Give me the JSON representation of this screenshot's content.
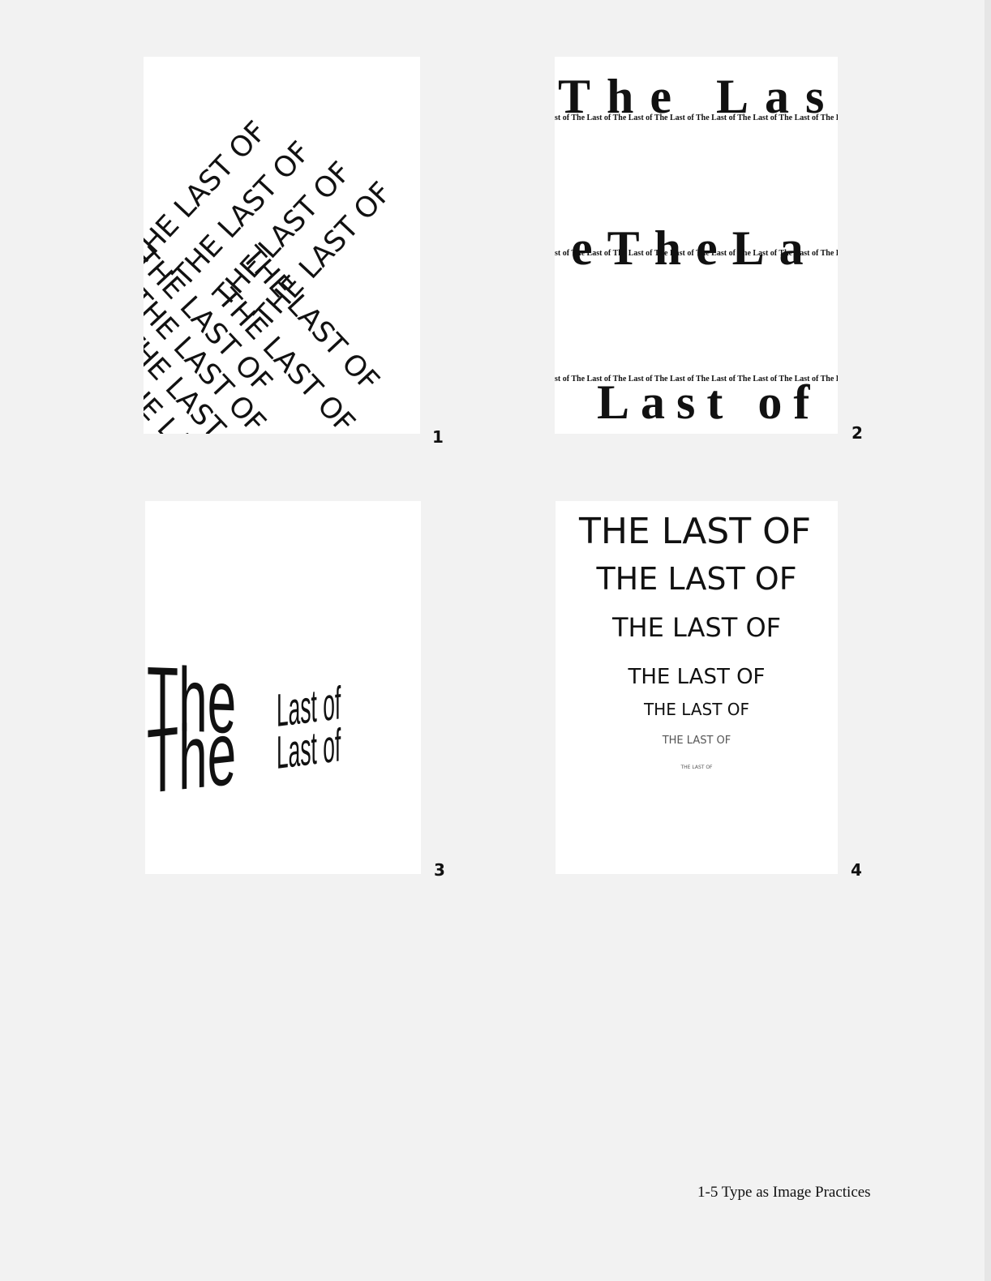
{
  "poster1": {
    "phrase": "THE LAST OF"
  },
  "poster2": {
    "large_top": "The Last",
    "large_mid": "eTheLa",
    "large_bottom": "Last of",
    "repeat_line": "st of The Last of The Last of The Last of The Last of The Last of The Last of The La"
  },
  "poster3": {
    "word_the": "The",
    "word_last_of": "Last of"
  },
  "poster4": {
    "lines": [
      "THE LAST OF",
      "THE LAST OF",
      "THE LAST OF",
      "THE LAST OF",
      "THE LAST OF",
      "THE LAST OF",
      "THE LAST OF"
    ]
  },
  "numbers": [
    "1",
    "2",
    "3",
    "4"
  ],
  "caption": "1-5 Type as Image Practices"
}
